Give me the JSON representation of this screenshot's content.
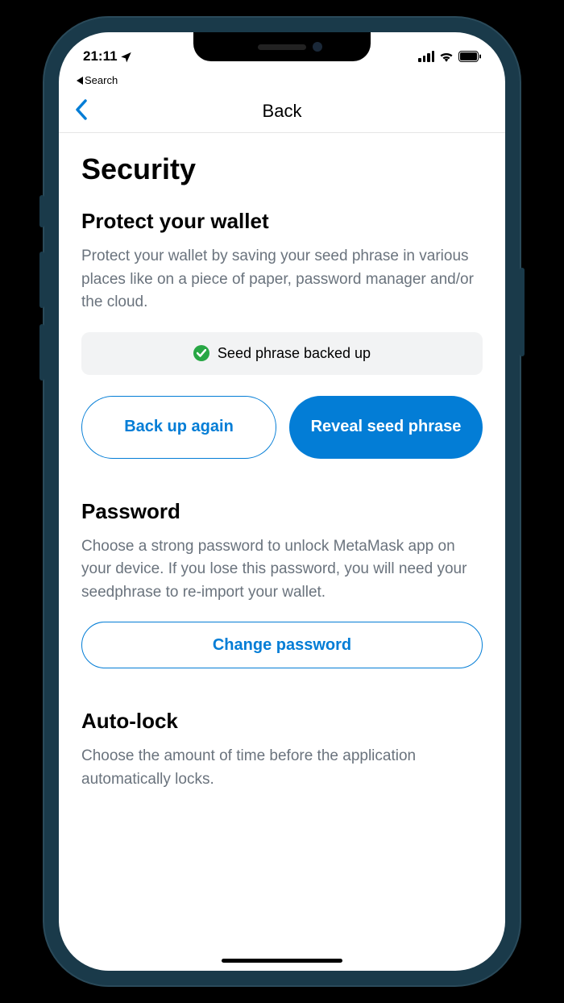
{
  "status_bar": {
    "time": "21:11",
    "back_app_label": "Search"
  },
  "nav": {
    "title": "Back"
  },
  "page": {
    "title": "Security"
  },
  "protect": {
    "heading": "Protect your wallet",
    "description": "Protect your wallet by saving your seed phrase in various places like on a piece of paper, password manager and/or the cloud.",
    "status_text": "Seed phrase backed up",
    "backup_button": "Back up again",
    "reveal_button": "Reveal seed phrase"
  },
  "password": {
    "heading": "Password",
    "description": "Choose a strong password to unlock MetaMask app on your device. If you lose this password, you will need your seedphrase to re-import your wallet.",
    "change_button": "Change password"
  },
  "autolock": {
    "heading": "Auto-lock",
    "description": "Choose the amount of time before the application automatically locks."
  },
  "colors": {
    "primary": "#037DD6",
    "success": "#28A745",
    "text_muted": "#6A737D"
  }
}
